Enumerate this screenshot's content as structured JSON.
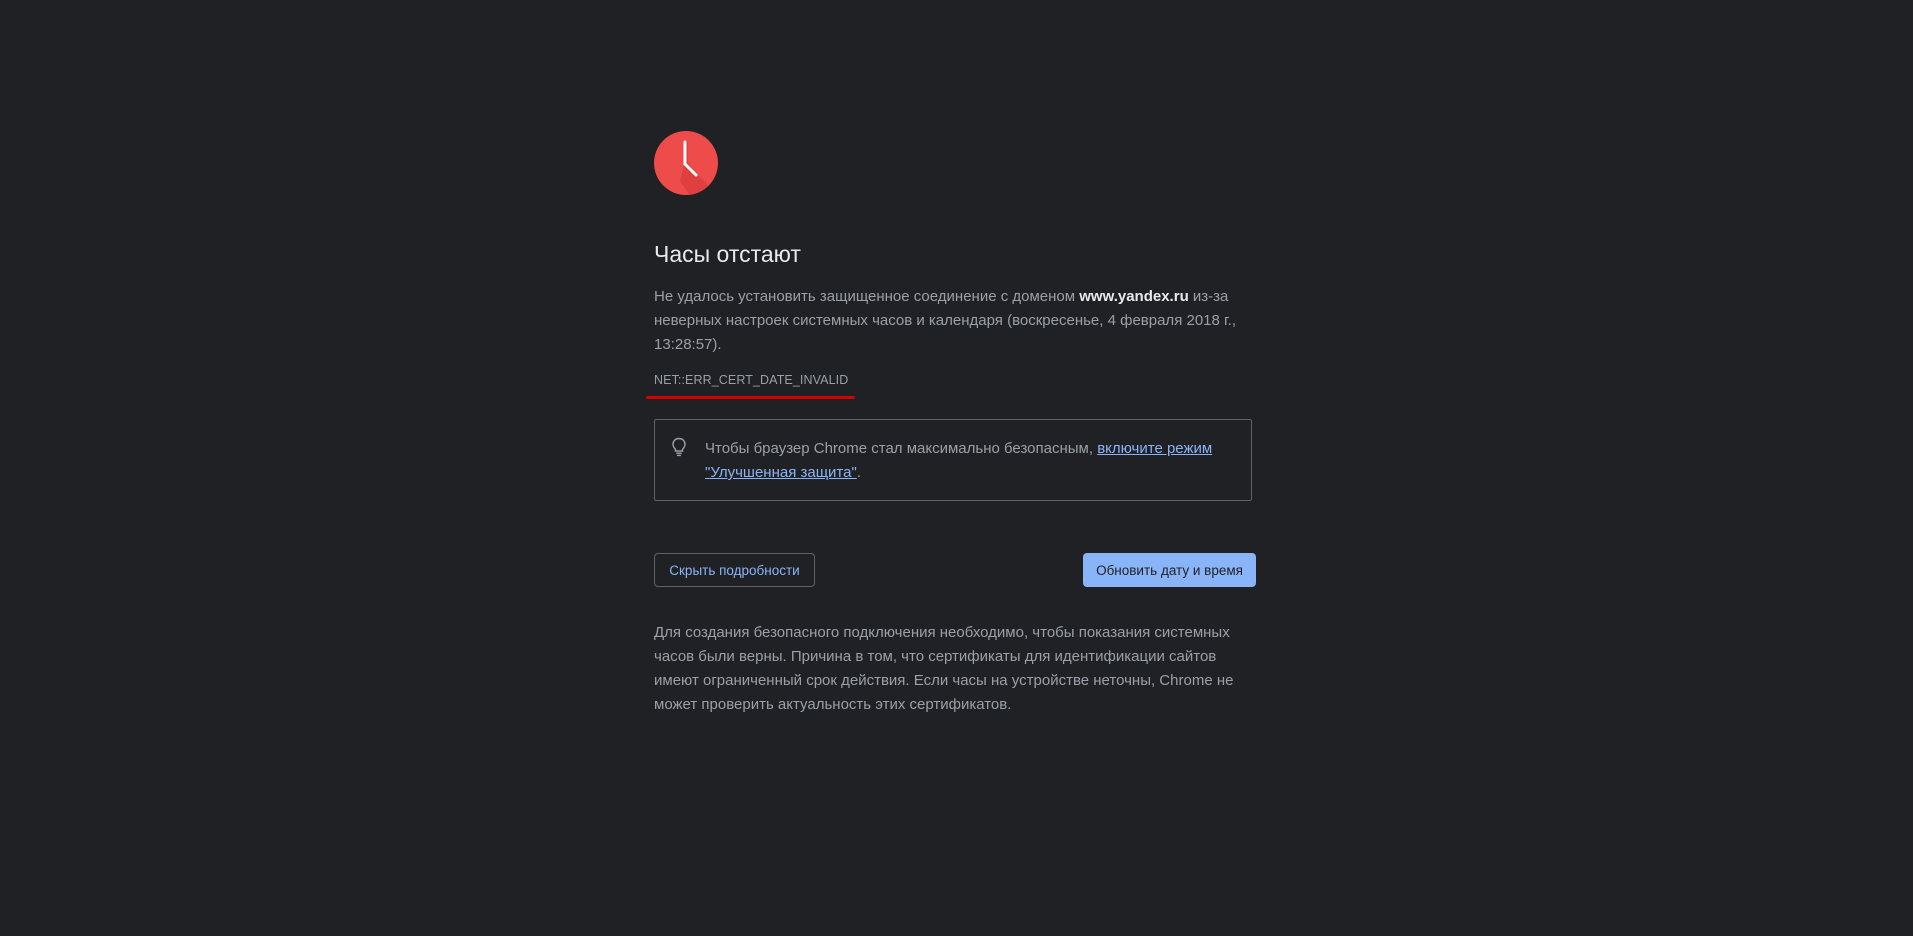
{
  "page": {
    "title": "Часы отстают",
    "main_text_before": "Не удалось установить защищенное соединение с доменом ",
    "domain": "www.yandex.ru",
    "main_text_after": " из-за неверных настроек системных часов и календаря (воскресенье, 4 февраля 2018 г., 13:28:57).",
    "error_code": "NET::ERR_CERT_DATE_INVALID"
  },
  "promo": {
    "text": "Чтобы браузер Chrome стал максимально безопасным, ",
    "link": "включите режим \"Улучшенная защита\"",
    "text_after": "."
  },
  "buttons": {
    "details_label": "Скрыть подробности",
    "primary_label": "Обновить дату и время"
  },
  "details": {
    "text": "Для создания безопасного подключения необходимо, чтобы показания системных часов были верны. Причина в том, что сертификаты для идентификации сайтов имеют ограниченный срок действия. Если часы на устройстве неточны, Chrome не может проверить актуальность этих сертификатов."
  },
  "colors": {
    "background": "#202124",
    "icon_red": "#ee4b4b",
    "accent_blue": "#8ab4f8",
    "underline_red": "#d40000"
  },
  "icons": {
    "main": "clock-icon",
    "promo": "lightbulb-icon"
  }
}
